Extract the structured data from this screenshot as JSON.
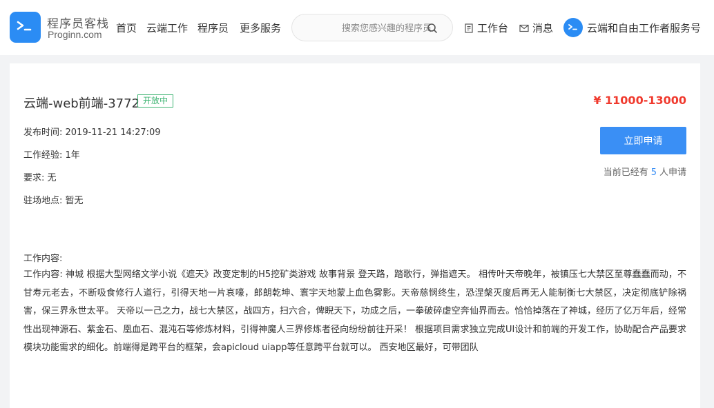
{
  "brand": {
    "name": "程序员客栈",
    "domain": "Proginn.com",
    "logo_icon": "terminal-prompt-icon",
    "accent": "#2b8cf4"
  },
  "nav": {
    "home": "首页",
    "cloud_work": "云端工作",
    "programmers": "程序员",
    "more_services": "更多服务"
  },
  "search": {
    "placeholder": "搜索您感兴趣的程序员",
    "icon": "search-icon"
  },
  "top_links": {
    "workbench": "工作台",
    "messages": "消息"
  },
  "service_account": {
    "name": "云端和自由工作者服务号"
  },
  "job": {
    "title": "云端-web前端-3772",
    "status": "开放中",
    "status_color": "#3cb371",
    "salary": "¥ 11000-13000",
    "salary_color": "#f03a2e",
    "publish_time": "发布时间: 2019-11-21 14:27:09",
    "experience": "工作经验: 1年",
    "requirements": "要求: 无",
    "location": "驻场地点: 暂无",
    "apply_label": "立即申请",
    "applicants_prefix": "当前已经有",
    "applicants_count": "5",
    "applicants_suffix": "人申请",
    "content_heading": "工作内容:",
    "content_text": "工作内容: 神城 根据大型网络文学小说《遮天》改变定制的H5挖矿类游戏 故事背景 登天路，踏歌行，弹指遮天。 相传叶天帝晚年，被镇压七大禁区至尊蠢蠢而动，不甘寿元老去，不断吸食修行人道行，引得天地一片哀嚎，郎朗乾坤、寰宇天地蒙上血色雾影。天帝慈悯终生，恐涅槃灭度后再无人能制衡七大禁区，决定彻底铲除祸害，保三界永世太平。 天帝以一己之力，战七大禁区，战四方，扫六合，俾睨天下，功成之后，一拳破碎虚空奔仙界而去。恰恰掉落在了神城，经历了亿万年后，经常性出现神源石、紫金石、凰血石、混沌石等修炼材料，引得神魔人三界修炼者径向纷纷前往开采！ 根据项目需求独立完成UI设计和前端的开发工作，协助配合产品要求模块功能需求的细化。前端得是跨平台的框架，会apicloud uiapp等任意跨平台就可以。 西安地区最好，可带团队",
    "apply_button_color": "#3a8ff5"
  }
}
